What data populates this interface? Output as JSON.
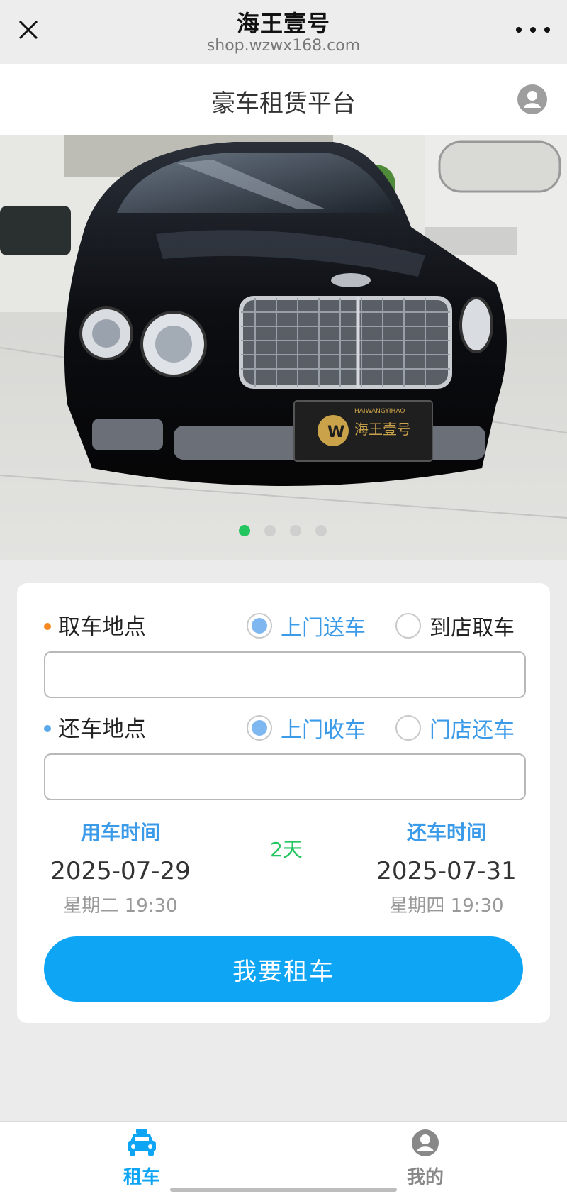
{
  "topbar": {
    "title": "海王壹号",
    "url": "shop.wzwx168.com"
  },
  "header": {
    "title": "豪车租赁平台"
  },
  "carousel": {
    "slide_count": 4,
    "active_index": 0,
    "plate_text": "海王壹号",
    "plate_sub": "HAIWANGYIHAO"
  },
  "pickup": {
    "label": "取车地点",
    "bullet_color": "#f5881f",
    "options": [
      {
        "label": "上门送车",
        "checked": true,
        "color": "#3b9be8"
      },
      {
        "label": "到店取车",
        "checked": false,
        "color": "#222222"
      }
    ],
    "value": "",
    "placeholder": ""
  },
  "return": {
    "label": "还车地点",
    "bullet_color": "#5aa9ea",
    "options": [
      {
        "label": "上门收车",
        "checked": true,
        "color": "#3b9be8"
      },
      {
        "label": "门店还车",
        "checked": false,
        "color": "#3b9be8"
      }
    ],
    "value": "",
    "placeholder": ""
  },
  "times": {
    "start": {
      "title": "用车时间",
      "date": "2025-07-29",
      "sub": "星期二 19:30"
    },
    "end": {
      "title": "还车时间",
      "date": "2025-07-31",
      "sub": "星期四 19:30"
    },
    "duration": "2天"
  },
  "actions": {
    "rent_label": "我要租车"
  },
  "tabbar": {
    "tabs": [
      {
        "label": "租车",
        "icon": "car-icon",
        "active": true,
        "color": "#0ea5f5"
      },
      {
        "label": "我的",
        "icon": "user-icon",
        "active": false,
        "color": "#888888"
      }
    ]
  },
  "colors": {
    "accent": "#0ea5f5",
    "link_blue": "#3b9be8",
    "green": "#22c55e"
  }
}
